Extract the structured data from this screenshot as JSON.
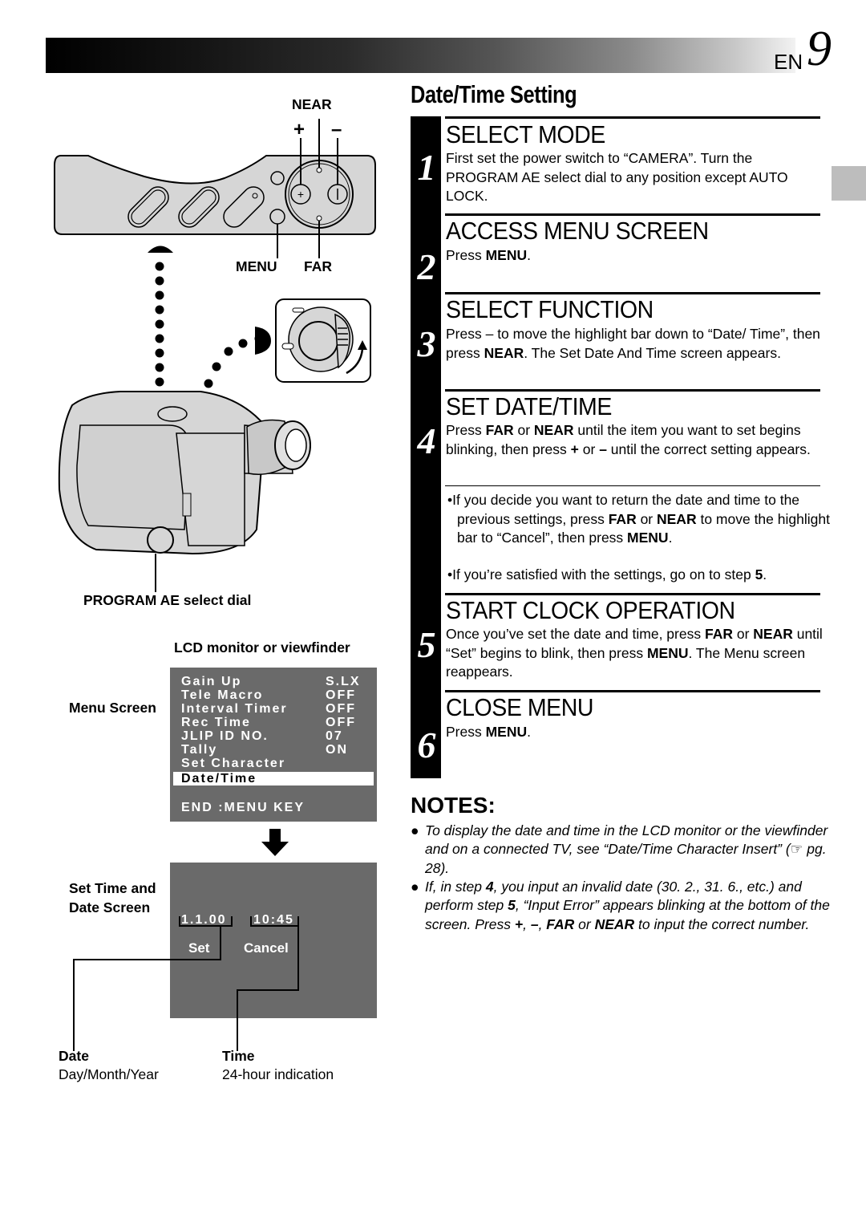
{
  "header": {
    "lang": "EN",
    "page_number": "9"
  },
  "title": "Date/Time Setting",
  "steps": [
    {
      "number": "1",
      "heading": "SELECT MODE",
      "body": "First set the power switch to “CAMERA”. Turn the PROGRAM AE select dial to any position except AUTO LOCK."
    },
    {
      "number": "2",
      "heading": "ACCESS MENU SCREEN",
      "body_prefix": "Press ",
      "body_bold": "MENU",
      "body_suffix": "."
    },
    {
      "number": "3",
      "heading": "SELECT FUNCTION",
      "body_a": "Press – to move the highlight bar down to “Date/ Time”, then press ",
      "body_bold": "NEAR",
      "body_b": ". The Set Date And Time screen appears."
    },
    {
      "number": "4",
      "heading": "SET DATE/TIME",
      "body_a": "Press ",
      "bold_far": "FAR",
      "body_b": " or ",
      "bold_near": "NEAR",
      "body_c": " until the item you want to set begins blinking, then press ",
      "bold_plus": "+",
      "body_d": " or ",
      "bold_minus": "–",
      "body_e": " until the correct setting appears.",
      "bullets": [
        {
          "a": "•If you decide you want to return the date and time to the previous settings, press ",
          "b1": "FAR",
          "c": " or ",
          "b2": "NEAR",
          "d": " to move the highlight bar to “Cancel”, then press ",
          "b3": "MENU",
          "e": "."
        },
        {
          "a": "•If you’re satisfied with the settings, go on to step ",
          "b1": "5",
          "e": "."
        }
      ]
    },
    {
      "number": "5",
      "heading": "START CLOCK OPERATION",
      "body_a": "Once you’ve set the  date and time, press ",
      "bold_far": "FAR",
      "body_b": " or ",
      "bold_near": "NEAR",
      "body_c": " until “Set” begins to blink, then press ",
      "bold_menu": "MENU",
      "body_d": ". The Menu screen reappears."
    },
    {
      "number": "6",
      "heading": "CLOSE MENU",
      "body_prefix": "Press ",
      "body_bold": "MENU",
      "body_suffix": "."
    }
  ],
  "notes": {
    "title": "NOTES:",
    "items": [
      {
        "a": "To display the date and time in the LCD monitor or the viewfinder and on a connected TV, see “Date/Time Character Insert” (",
        "icon": "☞",
        "b": " pg. 28)."
      },
      {
        "a": "If, in step ",
        "b1": "4",
        "c": ", you input an invalid date (30. 2., 31. 6., etc.) and perform step ",
        "b2": "5",
        "d": ", “Input Error” appears blinking at the bottom of the screen. Press ",
        "b3": "+",
        "e": ", ",
        "b4": "–",
        "f": ", ",
        "b5": "FAR",
        "g": " or ",
        "b6": "NEAR",
        "h": " to input the correct number."
      }
    ]
  },
  "diagram": {
    "near_label": "NEAR",
    "plus_label": "+",
    "minus_label": "–",
    "menu_label": "MENU",
    "far_label": "FAR",
    "dial_label": "PROGRAM AE select dial",
    "lcd_label": "LCD monitor or viewfinder",
    "menu_screen_label": "Menu Screen",
    "set_screen_label_1": "Set Time and",
    "set_screen_label_2": "Date Screen",
    "date_caption": "Date",
    "date_sub": "Day/Month/Year",
    "time_caption": "Time",
    "time_sub": "24-hour indication"
  },
  "menu_screen": {
    "rows": [
      {
        "label": "Gain Up",
        "value": "S.LX"
      },
      {
        "label": "Tele Macro",
        "value": "OFF"
      },
      {
        "label": "Interval Timer",
        "value": "OFF"
      },
      {
        "label": "Rec Time",
        "value": "OFF"
      },
      {
        "label": "JLIP ID NO.",
        "value": "07"
      },
      {
        "label": "Tally",
        "value": "ON"
      },
      {
        "label": "Set Character",
        "value": ""
      },
      {
        "label": "Date/Time",
        "value": "",
        "highlighted": true
      }
    ],
    "footer": "END :MENU KEY"
  },
  "date_screen": {
    "date_value": "1.1.00",
    "time_value": "10:45",
    "set_button": "Set",
    "cancel_button": "Cancel"
  }
}
